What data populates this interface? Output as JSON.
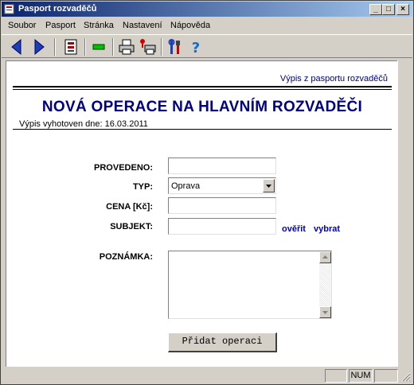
{
  "window": {
    "title": "Pasport rozvaděčů",
    "controls": {
      "minimize": "_",
      "maximize": "□",
      "close": "×"
    }
  },
  "menu": [
    "Soubor",
    "Pasport",
    "Stránka",
    "Nastavení",
    "Nápověda"
  ],
  "toolbar": {
    "icons": [
      "back-arrow-icon",
      "forward-arrow-icon",
      "document-icon",
      "green-bar-icon",
      "print-icon",
      "print-preview-icon",
      "tools-icon",
      "help-icon"
    ],
    "help_glyph": "?"
  },
  "report": {
    "header_link": "Výpis z pasportu rozvaděčů",
    "title": "NOVÁ OPERACE NA HLAVNÍM ROZVADĚČI",
    "issued": "Výpis vyhotoven dne: 16.03.2011"
  },
  "form": {
    "provedeno_label": "PROVEDENO:",
    "provedeno_value": "",
    "typ_label": "TYP:",
    "typ_value": "Oprava",
    "cena_label": "CENA [Kč]:",
    "cena_value": "",
    "subjekt_label": "SUBJEKT:",
    "subjekt_value": "",
    "overit_link": "ověřit",
    "vybrat_link": "vybrat",
    "poznamka_label": "POZNÁMKA:",
    "poznamka_value": "",
    "submit_label": "Přidat operaci"
  },
  "status": {
    "panel_1": "",
    "num": "NUM",
    "panel_3": ""
  },
  "colors": {
    "accent": "#000080",
    "link": "#0000c0",
    "title_bar": "#0a246a"
  }
}
